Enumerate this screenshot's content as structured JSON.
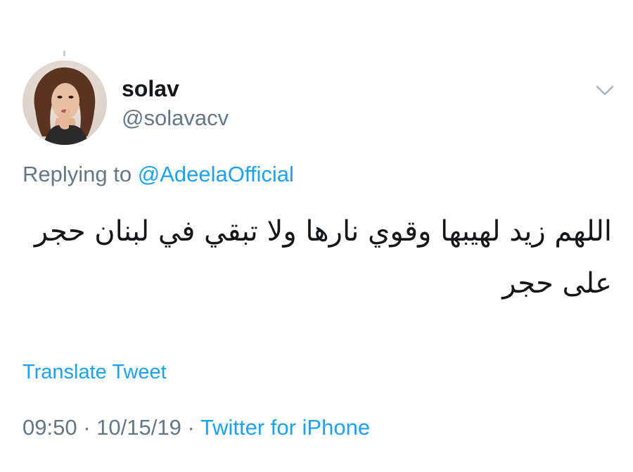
{
  "tweet": {
    "author": {
      "display_name": "solav",
      "handle": "@solavacv",
      "avatar_icon": "profile-photo"
    },
    "menu_icon": "chevron-down-icon",
    "reply": {
      "prefix": "Replying to",
      "mention": "@AdeelaOfficial"
    },
    "text": "اللهم زيد لهيبها وقوي نارها ولا تبقي في لبنان حجر على حجر",
    "translate_label": "Translate Tweet",
    "meta": {
      "time": "09:50",
      "separator": "·",
      "date": "10/15/19",
      "source": "Twitter for iPhone"
    }
  },
  "colors": {
    "text": "#14171a",
    "secondary": "#657786",
    "link": "#1da1f2",
    "background": "#ffffff"
  }
}
